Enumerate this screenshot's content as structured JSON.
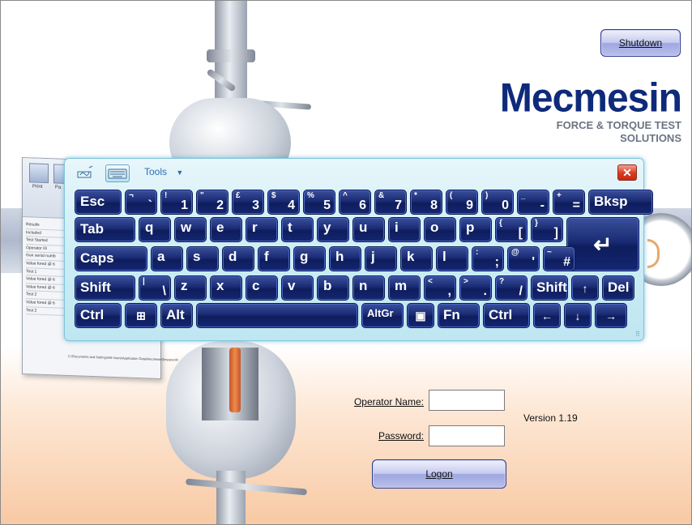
{
  "header": {
    "shutdown_label": "Shutdown"
  },
  "logo": {
    "brand": "Mecmesin",
    "tagline": "FORCE & TORQUE TEST SOLUTIONS"
  },
  "login": {
    "operator_label": "Operator Name:",
    "operator_value": "",
    "password_label": "Password:",
    "password_value": "",
    "logon_label": "Logon",
    "version": "Version 1.19"
  },
  "report_window": {
    "toolbar": [
      "Print",
      "Pa"
    ],
    "rows": [
      "Results",
      "Included",
      "Test Started",
      "Operator ID",
      "Gun serial numb",
      "Value fored @ 6",
      "Test 1",
      "Value fored @ 6",
      "Value fored @ 6",
      "Test 2",
      "Value fored @ 6",
      "Test 2"
    ],
    "path": "C:\\Documents and Settings\\All Users\\Application Data\\Mecmesin\\Emperor\\R"
  },
  "osk": {
    "tools_label": "Tools",
    "close_symbol": "✕",
    "rows": [
      [
        {
          "main": "Esc",
          "w": 58
        },
        {
          "sym": "¬",
          "num": "`",
          "w": 40
        },
        {
          "sym": "!",
          "num": "1",
          "w": 40
        },
        {
          "sym": "\"",
          "num": "2",
          "w": 40
        },
        {
          "sym": "£",
          "num": "3",
          "w": 40
        },
        {
          "sym": "$",
          "num": "4",
          "w": 40
        },
        {
          "sym": "%",
          "num": "5",
          "w": 40
        },
        {
          "sym": "^",
          "num": "6",
          "w": 40
        },
        {
          "sym": "&",
          "num": "7",
          "w": 40
        },
        {
          "sym": "*",
          "num": "8",
          "w": 40
        },
        {
          "sym": "(",
          "num": "9",
          "w": 40
        },
        {
          "sym": ")",
          "num": "0",
          "w": 40
        },
        {
          "sym": "_",
          "num": "-",
          "w": 40
        },
        {
          "sym": "+",
          "num": "=",
          "w": 40
        },
        {
          "main": "Bksp",
          "w": 80
        }
      ],
      [
        {
          "main": "Tab",
          "w": 75
        },
        {
          "ltr": "q",
          "w": 40
        },
        {
          "ltr": "w",
          "w": 40
        },
        {
          "ltr": "e",
          "w": 40
        },
        {
          "ltr": "r",
          "w": 40
        },
        {
          "ltr": "t",
          "w": 40
        },
        {
          "ltr": "y",
          "w": 40
        },
        {
          "ltr": "u",
          "w": 40
        },
        {
          "ltr": "i",
          "w": 40
        },
        {
          "ltr": "o",
          "w": 40
        },
        {
          "ltr": "p",
          "w": 40
        },
        {
          "sym": "{",
          "num": "[",
          "w": 40
        },
        {
          "sym": "}",
          "num": "]",
          "w": 40
        },
        {
          "main": "Enter",
          "icon": "↵",
          "w": 90
        }
      ],
      [
        {
          "main": "Caps",
          "w": 90
        },
        {
          "ltr": "a",
          "w": 40
        },
        {
          "ltr": "s",
          "w": 40
        },
        {
          "ltr": "d",
          "w": 40
        },
        {
          "ltr": "f",
          "w": 40
        },
        {
          "ltr": "g",
          "w": 40
        },
        {
          "ltr": "h",
          "w": 40
        },
        {
          "ltr": "j",
          "w": 40
        },
        {
          "ltr": "k",
          "w": 40
        },
        {
          "ltr": "l",
          "w": 40
        },
        {
          "sym": ":",
          "num": ";",
          "w": 40
        },
        {
          "sym": "@",
          "num": "'",
          "w": 40
        },
        {
          "sym": "~",
          "num": "#",
          "w": 40
        }
      ],
      [
        {
          "main": "Shift",
          "w": 75
        },
        {
          "sym": "|",
          "num": "\\",
          "w": 40
        },
        {
          "ltr": "z",
          "w": 40
        },
        {
          "ltr": "x",
          "w": 40
        },
        {
          "ltr": "c",
          "w": 40
        },
        {
          "ltr": "v",
          "w": 40
        },
        {
          "ltr": "b",
          "w": 40
        },
        {
          "ltr": "n",
          "w": 40
        },
        {
          "ltr": "m",
          "w": 40
        },
        {
          "sym": "<",
          "num": ",",
          "w": 40
        },
        {
          "sym": ">",
          "num": ".",
          "w": 40
        },
        {
          "sym": "?",
          "num": "/",
          "w": 40
        },
        {
          "main": "Shift",
          "w": 46
        },
        {
          "main": "↑",
          "w": 34
        },
        {
          "main": "Del",
          "w": 40
        }
      ],
      [
        {
          "main": "Ctrl",
          "w": 58
        },
        {
          "main": "⊞",
          "w": 40
        },
        {
          "main": "Alt",
          "w": 40
        },
        {
          "main": "",
          "w": 200
        },
        {
          "main": "AltGr",
          "w": 52
        },
        {
          "main": "▣",
          "w": 34
        },
        {
          "main": "Fn",
          "w": 52
        },
        {
          "main": "Ctrl",
          "w": 58
        },
        {
          "main": "←",
          "w": 34
        },
        {
          "main": "↓",
          "w": 34
        },
        {
          "main": "→",
          "w": 40
        }
      ]
    ]
  }
}
